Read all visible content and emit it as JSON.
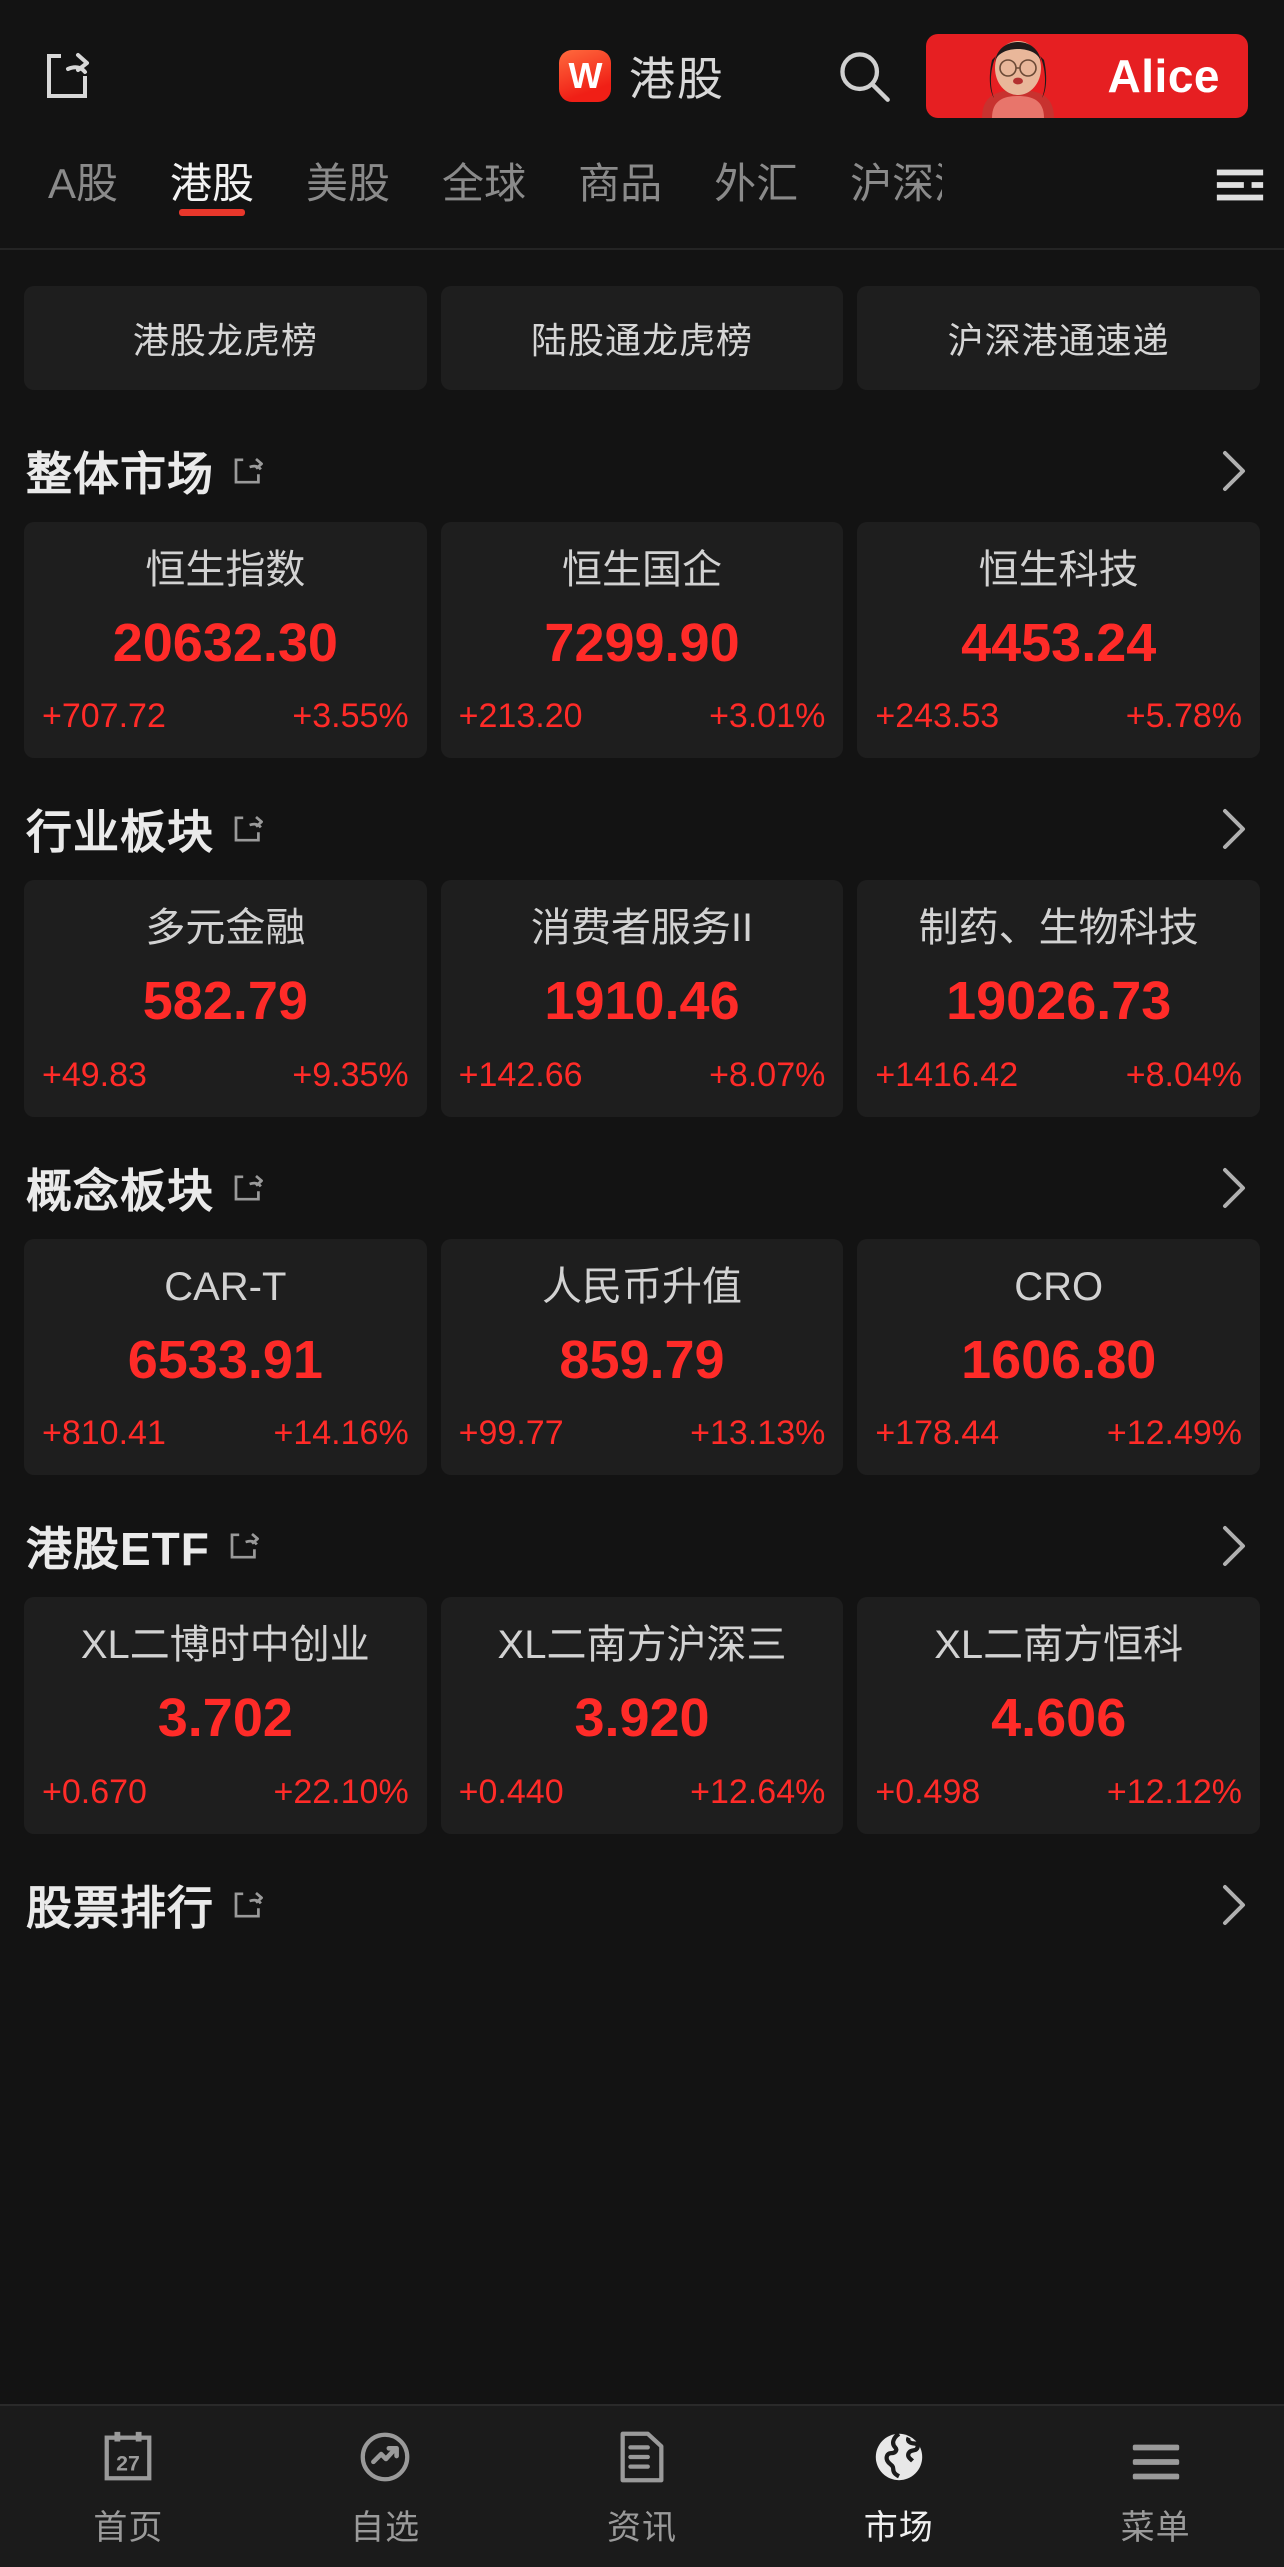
{
  "header": {
    "share_icon": "share-icon",
    "brand_mark": "W",
    "brand_title": "港股",
    "search_icon": "search-icon",
    "user_name": "Alice",
    "accent_red": "#e61f22"
  },
  "tabs": {
    "items": [
      {
        "label": "A股",
        "active": false
      },
      {
        "label": "港股",
        "active": true
      },
      {
        "label": "美股",
        "active": false
      },
      {
        "label": "全球",
        "active": false
      },
      {
        "label": "商品",
        "active": false
      },
      {
        "label": "外汇",
        "active": false
      },
      {
        "label": "沪深港",
        "active": false
      }
    ],
    "more_icon": "hamburger-menu-icon"
  },
  "quick_links": [
    {
      "label": "港股龙虎榜"
    },
    {
      "label": "陆股通龙虎榜"
    },
    {
      "label": "沪深港通速递"
    }
  ],
  "sections": [
    {
      "title": "整体市场",
      "external_icon": "external-link-icon",
      "arrow_icon": "chevron-right-icon",
      "cards": [
        {
          "name": "恒生指数",
          "price": "20632.30",
          "change": "+707.72",
          "percent": "+3.55%"
        },
        {
          "name": "恒生国企",
          "price": "7299.90",
          "change": "+213.20",
          "percent": "+3.01%"
        },
        {
          "name": "恒生科技",
          "price": "4453.24",
          "change": "+243.53",
          "percent": "+5.78%"
        }
      ]
    },
    {
      "title": "行业板块",
      "external_icon": "external-link-icon",
      "arrow_icon": "chevron-right-icon",
      "cards": [
        {
          "name": "多元金融",
          "price": "582.79",
          "change": "+49.83",
          "percent": "+9.35%"
        },
        {
          "name": "消费者服务II",
          "price": "1910.46",
          "change": "+142.66",
          "percent": "+8.07%"
        },
        {
          "name": "制药、生物科技",
          "price": "19026.73",
          "change": "+1416.42",
          "percent": "+8.04%"
        }
      ]
    },
    {
      "title": "概念板块",
      "external_icon": "external-link-icon",
      "arrow_icon": "chevron-right-icon",
      "cards": [
        {
          "name": "CAR-T",
          "price": "6533.91",
          "change": "+810.41",
          "percent": "+14.16%"
        },
        {
          "name": "人民币升值",
          "price": "859.79",
          "change": "+99.77",
          "percent": "+13.13%"
        },
        {
          "name": "CRO",
          "price": "1606.80",
          "change": "+178.44",
          "percent": "+12.49%"
        }
      ]
    },
    {
      "title": "港股ETF",
      "external_icon": "external-link-icon",
      "arrow_icon": "chevron-right-icon",
      "cards": [
        {
          "name": "XL二博时中创业",
          "price": "3.702",
          "change": "+0.670",
          "percent": "+22.10%"
        },
        {
          "name": "XL二南方沪深三",
          "price": "3.920",
          "change": "+0.440",
          "percent": "+12.64%"
        },
        {
          "name": "XL二南方恒科",
          "price": "4.606",
          "change": "+0.498",
          "percent": "+12.12%"
        }
      ]
    },
    {
      "title": "股票排行",
      "external_icon": "external-link-icon",
      "arrow_icon": "chevron-right-icon",
      "cards": []
    }
  ],
  "bottom_nav": [
    {
      "label": "首页",
      "icon": "calendar-27-icon",
      "active": false
    },
    {
      "label": "自选",
      "icon": "trend-circle-icon",
      "active": false
    },
    {
      "label": "资讯",
      "icon": "document-icon",
      "active": false
    },
    {
      "label": "市场",
      "icon": "globe-icon",
      "active": true
    },
    {
      "label": "菜单",
      "icon": "hamburger-menu-icon",
      "active": false
    }
  ],
  "colors": {
    "up_red": "#ff2b28",
    "brand_red": "#e8372b",
    "card_bg": "#1e1e1e",
    "page_bg": "#131313"
  }
}
